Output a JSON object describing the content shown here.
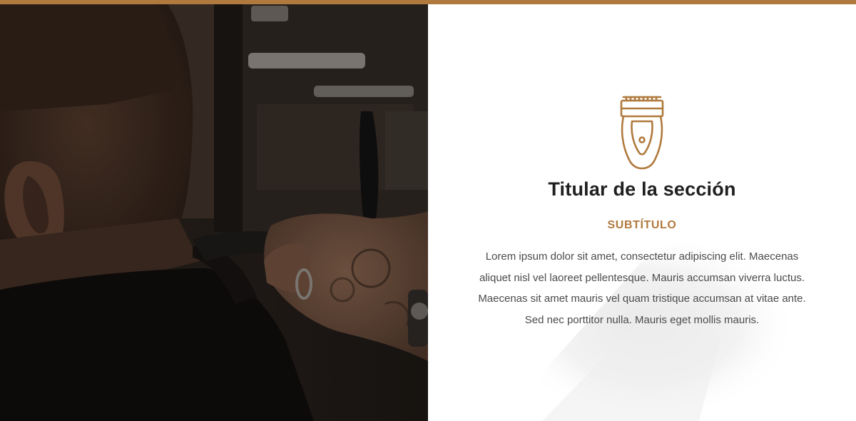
{
  "section": {
    "title": "Titular de la sección",
    "subtitle": "SUBTÍTULO",
    "body": "Lorem ipsum dolor sit amet, consectetur adipiscing elit. Maecenas aliquet nisl vel laoreet pellentesque. Mauris accumsan viverra luctus. Maecenas sit amet mauris vel quam tristique accumsan at vitae ante. Sed nec porttitor nulla. Mauris eget mollis mauris."
  },
  "icons": {
    "feature_icon": "hair-clipper-icon"
  },
  "colors": {
    "accent": "#b07a3e",
    "title": "#1f1f1f",
    "body_text": "#4b4b4b",
    "background": "#ffffff"
  }
}
